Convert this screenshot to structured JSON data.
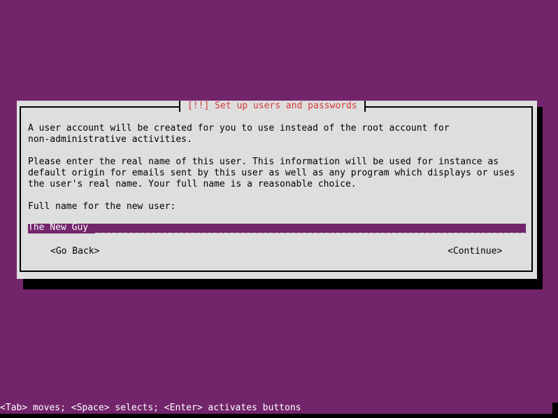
{
  "dialog": {
    "title": "[!!] Set up users and passwords",
    "paragraph1": [
      "A user account will be created for you to use instead of the root account for",
      "non-administrative activities."
    ],
    "paragraph2": [
      "Please enter the real name of this user. This information will be used for instance as",
      "default origin for emails sent by this user as well as any program which displays or uses",
      "the user's real name. Your full name is a reasonable choice."
    ],
    "field_label": "Full name for the new user:",
    "field_value": "The New Guy",
    "go_back_label": "<Go Back>",
    "continue_label": "<Continue>"
  },
  "statusbar": {
    "help": "<Tab> moves; <Space> selects; <Enter> activates buttons"
  },
  "colors": {
    "background": "#73256c",
    "dialog": "#dedede",
    "title": "#d43a3a"
  }
}
